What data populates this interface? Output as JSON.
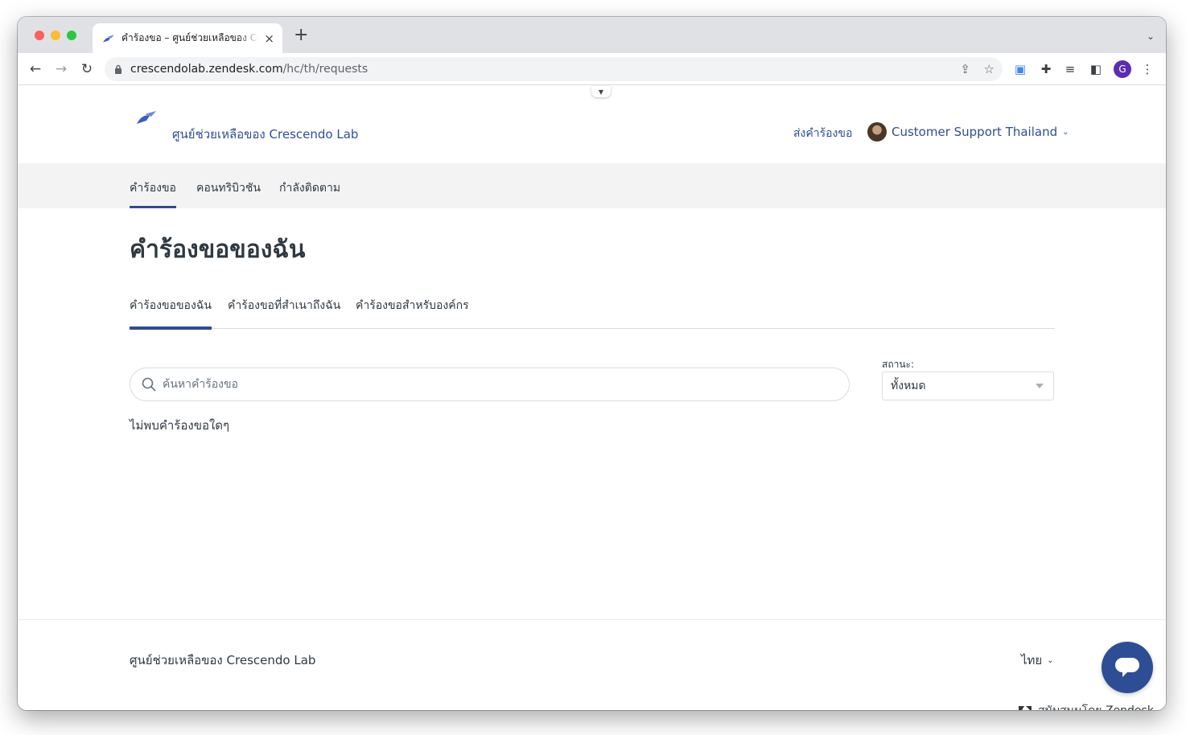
{
  "browser": {
    "tab_title": "คำร้องขอ – ศูนย์ช่วยเหลือของ Crescendo Lab",
    "tab_close": "×",
    "new_tab": "+",
    "url_host": "crescendolab.zendesk.com",
    "url_path": "/hc/th/requests",
    "profile_initial": "G",
    "icons": [
      "back-icon",
      "forward-icon",
      "reload-icon",
      "lock-icon",
      "share-icon",
      "star-icon",
      "extension-icon",
      "puzzle-icon",
      "media-icon",
      "sidepanel-icon",
      "more-icon"
    ]
  },
  "header": {
    "brand_name": "ศูนย์ช่วยเหลือของ Crescendo Lab",
    "submit_request": "ส่งคำร้องขอ",
    "user_name": "Customer Support Thailand",
    "user_chevron": "⌄"
  },
  "subnav": {
    "items": [
      {
        "label": "คำร้องขอ",
        "active": true
      },
      {
        "label": "คอนทริบิวชัน",
        "active": false
      },
      {
        "label": "กำลังติดตาม",
        "active": false
      }
    ]
  },
  "main": {
    "title": "คำร้องขอของฉัน",
    "tabs": [
      {
        "label": "คำร้องขอของฉัน",
        "active": true
      },
      {
        "label": "คำร้องขอที่สำเนาถึงฉัน",
        "active": false
      },
      {
        "label": "คำร้องขอสำหรับองค์กร",
        "active": false
      }
    ],
    "search_placeholder": "ค้นหาคำร้องขอ",
    "status_label": "สถานะ:",
    "status_value": "ทั้งหมด",
    "no_results": "ไม่พบคำร้องขอใดๆ"
  },
  "footer": {
    "brand_name": "ศูนย์ช่วยเหลือของ Crescendo Lab",
    "language": "ไทย",
    "language_chevron": "⌄",
    "powered_by": "สนับสนุนโดย Zendesk"
  },
  "colors": {
    "accent": "#2d4e94",
    "text": "#2f3941",
    "subnav_bg": "#f3f3f3"
  }
}
